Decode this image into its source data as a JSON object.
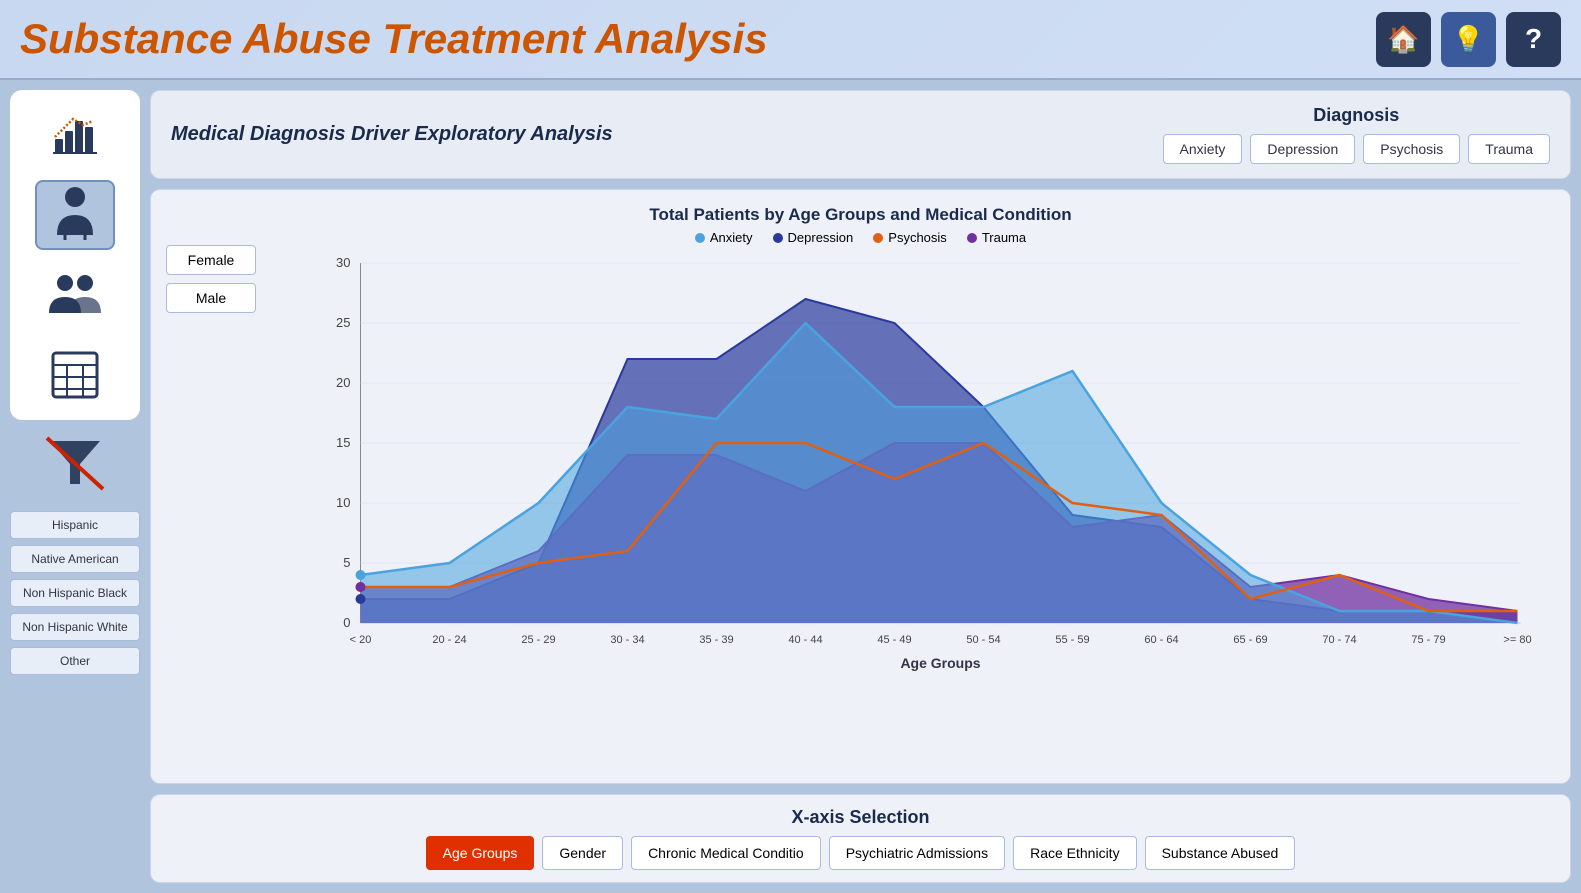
{
  "header": {
    "title": "Substance Abuse Treatment Analysis",
    "icons": [
      {
        "name": "home-icon",
        "symbol": "🏠"
      },
      {
        "name": "lightbulb-icon",
        "symbol": "💡"
      },
      {
        "name": "question-icon",
        "symbol": "?"
      }
    ]
  },
  "sidebar": {
    "icons": [
      {
        "name": "bar-chart-icon",
        "symbol": "📊",
        "active": false
      },
      {
        "name": "person-icon",
        "symbol": "👤",
        "active": true
      },
      {
        "name": "group-icon",
        "symbol": "👥",
        "active": false
      },
      {
        "name": "table-icon",
        "symbol": "⊞",
        "active": false
      }
    ],
    "filter_icon": {
      "name": "no-filter-icon",
      "symbol": "🔕"
    },
    "race_filters": [
      {
        "label": "Hispanic",
        "name": "hispanic-filter"
      },
      {
        "label": "Native American",
        "name": "native-american-filter"
      },
      {
        "label": "Non Hispanic Black",
        "name": "non-hispanic-black-filter"
      },
      {
        "label": "Non Hispanic White",
        "name": "non-hispanic-white-filter"
      },
      {
        "label": "Other",
        "name": "other-filter"
      }
    ]
  },
  "diagnosis": {
    "subtitle": "Medical Diagnosis Driver Exploratory Analysis",
    "label": "Diagnosis",
    "buttons": [
      {
        "label": "Anxiety",
        "active": false
      },
      {
        "label": "Depression",
        "active": false
      },
      {
        "label": "Psychosis",
        "active": false
      },
      {
        "label": "Trauma",
        "active": false
      }
    ]
  },
  "chart": {
    "title": "Total Patients by Age Groups and Medical Condition",
    "legend": [
      {
        "label": "Anxiety",
        "color": "#4aa3df"
      },
      {
        "label": "Depression",
        "color": "#2a3a9c"
      },
      {
        "label": "Psychosis",
        "color": "#e06010"
      },
      {
        "label": "Trauma",
        "color": "#7030a0"
      }
    ],
    "y_axis": {
      "max": 30,
      "ticks": [
        0,
        5,
        10,
        15,
        20,
        25,
        30
      ]
    },
    "x_axis": {
      "label": "Age Groups",
      "categories": [
        "< 20",
        "20 - 24",
        "25 - 29",
        "30 - 34",
        "35 - 39",
        "40 - 44",
        "45 - 49",
        "50 - 54",
        "55 - 59",
        "60 - 64",
        "65 - 69",
        "70 - 74",
        "75 - 79",
        ">= 80"
      ]
    },
    "gender_buttons": [
      {
        "label": "Female"
      },
      {
        "label": "Male"
      }
    ],
    "series": {
      "anxiety": [
        4,
        5,
        10,
        18,
        17,
        25,
        18,
        18,
        21,
        10,
        4,
        1,
        1,
        0
      ],
      "depression": [
        2,
        2,
        5,
        22,
        22,
        27,
        25,
        18,
        9,
        8,
        2,
        1,
        1,
        1
      ],
      "psychosis": [
        3,
        3,
        5,
        6,
        15,
        15,
        12,
        15,
        10,
        9,
        2,
        4,
        1,
        1
      ],
      "trauma": [
        3,
        3,
        6,
        14,
        14,
        11,
        15,
        15,
        8,
        9,
        3,
        4,
        2,
        1
      ]
    }
  },
  "xaxis_selection": {
    "title": "X-axis Selection",
    "buttons": [
      {
        "label": "Age Groups",
        "active": true
      },
      {
        "label": "Gender",
        "active": false
      },
      {
        "label": "Chronic Medical Conditio",
        "active": false
      },
      {
        "label": "Psychiatric Admissions",
        "active": false
      },
      {
        "label": "Race Ethnicity",
        "active": false
      },
      {
        "label": "Substance Abused",
        "active": false
      }
    ]
  }
}
